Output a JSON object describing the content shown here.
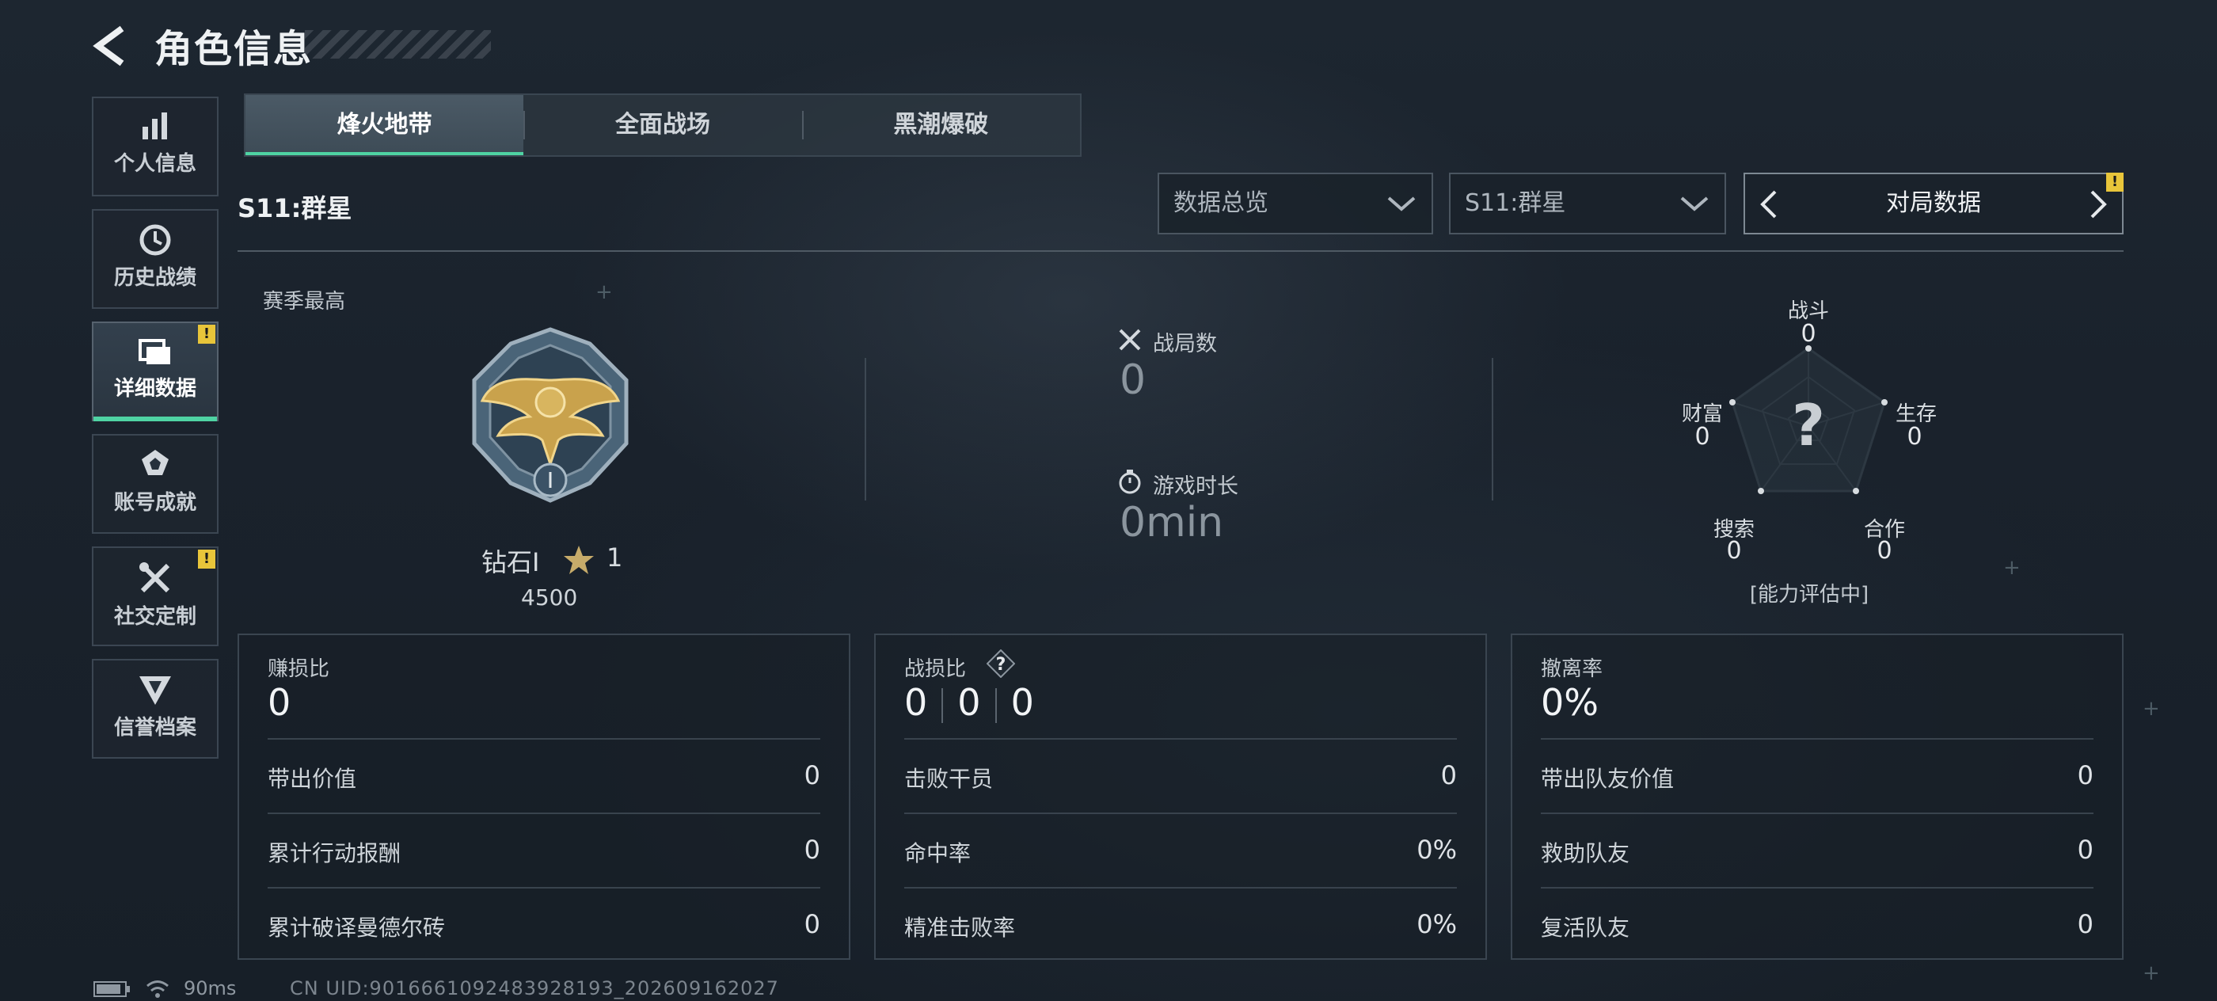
{
  "header": {
    "title": "角色信息"
  },
  "sidebar": {
    "items": [
      {
        "label": "个人信息",
        "icon": "bar-chart-icon",
        "active": false,
        "badge": ""
      },
      {
        "label": "历史战绩",
        "icon": "clock-icon",
        "active": false,
        "badge": ""
      },
      {
        "label": "详细数据",
        "icon": "folder-icon",
        "active": true,
        "badge": "!"
      },
      {
        "label": "账号成就",
        "icon": "medal-icon",
        "active": false,
        "badge": ""
      },
      {
        "label": "社交定制",
        "icon": "tools-icon",
        "active": false,
        "badge": "!"
      },
      {
        "label": "信誉档案",
        "icon": "shield-icon",
        "active": false,
        "badge": ""
      }
    ]
  },
  "mode_tabs": [
    {
      "label": "烽火地带",
      "active": true
    },
    {
      "label": "全面战场",
      "active": false
    },
    {
      "label": "黑潮爆破",
      "active": false
    }
  ],
  "season_label": "S11:群星",
  "filters": {
    "overview": "数据总览",
    "season": "S11:群星",
    "stat_switcher": "对局数据",
    "stat_switcher_badge": "!"
  },
  "season_best": {
    "title": "赛季最高",
    "rank": "钻石Ⅰ",
    "stars": "1",
    "score": "4500"
  },
  "match_stats": {
    "matches_label": "战局数",
    "matches_value": "0",
    "playtime_label": "游戏时长",
    "playtime_value": "0min"
  },
  "radar": {
    "center": "?",
    "axes": [
      {
        "label": "战斗",
        "value": "0"
      },
      {
        "label": "生存",
        "value": "0"
      },
      {
        "label": "合作",
        "value": "0"
      },
      {
        "label": "搜索",
        "value": "0"
      },
      {
        "label": "财富",
        "value": "0"
      }
    ],
    "note": "[能力评估中]"
  },
  "panels": {
    "profit": {
      "title": "赚损比",
      "big": "0",
      "rows": [
        {
          "label": "带出价值",
          "value": "0"
        },
        {
          "label": "累计行动报酬",
          "value": "0"
        },
        {
          "label": "累计破译曼德尔砖",
          "value": "0"
        }
      ]
    },
    "kd": {
      "title": "战损比",
      "help": "?",
      "big": [
        "0",
        "0",
        "0"
      ],
      "rows": [
        {
          "label": "击败干员",
          "value": "0"
        },
        {
          "label": "命中率",
          "value": "0%"
        },
        {
          "label": "精准击败率",
          "value": "0%"
        }
      ]
    },
    "extract": {
      "title": "撤离率",
      "big": "0%",
      "rows": [
        {
          "label": "带出队友价值",
          "value": "0"
        },
        {
          "label": "救助队友",
          "value": "0"
        },
        {
          "label": "复活队友",
          "value": "0"
        }
      ]
    }
  },
  "status": {
    "ping": "90ms",
    "uid": "CN UID:9016661092483928193_202609162027"
  },
  "colors": {
    "accent": "#4fd3a3",
    "warning": "#e8c53a",
    "background": "#1b242e"
  }
}
